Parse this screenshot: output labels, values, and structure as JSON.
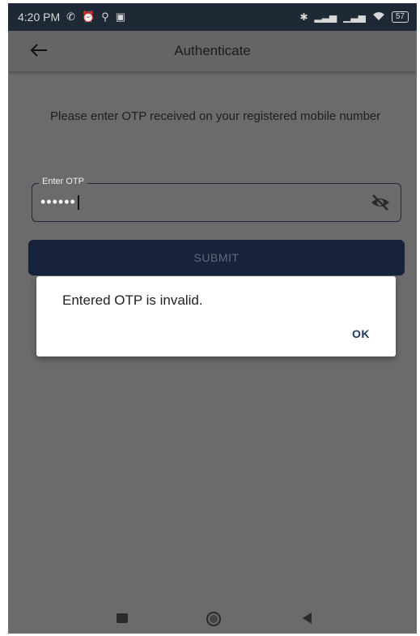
{
  "status_bar": {
    "time": "4:20 PM",
    "left_icons": [
      "whatsapp-icon",
      "alarm-icon",
      "signal-badge-icon",
      "app-icon"
    ],
    "right_icons": [
      "bluetooth-icon",
      "cell-signal-icon",
      "cell-signal-2-icon",
      "wifi-icon"
    ],
    "battery": "57"
  },
  "app_bar": {
    "back_icon": "arrow-left-icon",
    "title": "Authenticate"
  },
  "form": {
    "instruction": "Please enter OTP received on your registered mobile number",
    "otp_label": "Enter OTP",
    "otp_value": "••••••",
    "visibility_icon": "eye-off-icon",
    "submit_label": "SUBMIT"
  },
  "dialog": {
    "message": "Entered OTP is invalid.",
    "ok_label": "OK"
  },
  "nav_bar": {
    "icons": [
      "recents-icon",
      "home-icon",
      "back-icon"
    ]
  },
  "colors": {
    "status_bg": "#1f2936",
    "overlay_bg": "#6b6b6b",
    "button_bg": "#17233a",
    "dialog_bg": "#ffffff",
    "accent": "#1e3a5c"
  }
}
